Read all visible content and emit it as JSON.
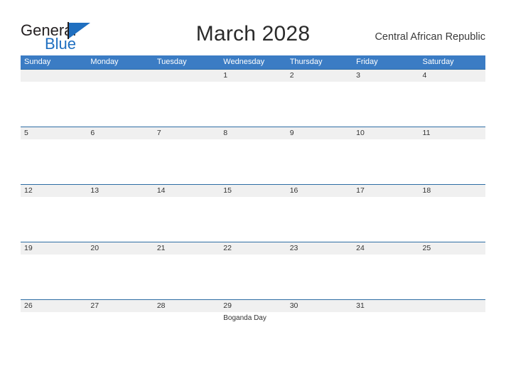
{
  "brand": {
    "name_dark": "General",
    "name_blue": "Blue",
    "accent_color": "#1f6fc0",
    "logo_icon": "triangle-flag-icon"
  },
  "header": {
    "title": "March 2028",
    "region": "Central African Republic"
  },
  "theme": {
    "header_bar_color": "#3b7cc4",
    "band_color": "#f0f0f0",
    "rule_color": "#2e6da4",
    "text_color": "#333333"
  },
  "calendar": {
    "weekday_headers": [
      "Sunday",
      "Monday",
      "Tuesday",
      "Wednesday",
      "Thursday",
      "Friday",
      "Saturday"
    ],
    "weeks": [
      [
        {
          "day": "",
          "event": ""
        },
        {
          "day": "",
          "event": ""
        },
        {
          "day": "",
          "event": ""
        },
        {
          "day": "1",
          "event": ""
        },
        {
          "day": "2",
          "event": ""
        },
        {
          "day": "3",
          "event": ""
        },
        {
          "day": "4",
          "event": ""
        }
      ],
      [
        {
          "day": "5",
          "event": ""
        },
        {
          "day": "6",
          "event": ""
        },
        {
          "day": "7",
          "event": ""
        },
        {
          "day": "8",
          "event": ""
        },
        {
          "day": "9",
          "event": ""
        },
        {
          "day": "10",
          "event": ""
        },
        {
          "day": "11",
          "event": ""
        }
      ],
      [
        {
          "day": "12",
          "event": ""
        },
        {
          "day": "13",
          "event": ""
        },
        {
          "day": "14",
          "event": ""
        },
        {
          "day": "15",
          "event": ""
        },
        {
          "day": "16",
          "event": ""
        },
        {
          "day": "17",
          "event": ""
        },
        {
          "day": "18",
          "event": ""
        }
      ],
      [
        {
          "day": "19",
          "event": ""
        },
        {
          "day": "20",
          "event": ""
        },
        {
          "day": "21",
          "event": ""
        },
        {
          "day": "22",
          "event": ""
        },
        {
          "day": "23",
          "event": ""
        },
        {
          "day": "24",
          "event": ""
        },
        {
          "day": "25",
          "event": ""
        }
      ],
      [
        {
          "day": "26",
          "event": ""
        },
        {
          "day": "27",
          "event": ""
        },
        {
          "day": "28",
          "event": ""
        },
        {
          "day": "29",
          "event": "Boganda Day"
        },
        {
          "day": "30",
          "event": ""
        },
        {
          "day": "31",
          "event": ""
        },
        {
          "day": "",
          "event": ""
        }
      ]
    ]
  }
}
